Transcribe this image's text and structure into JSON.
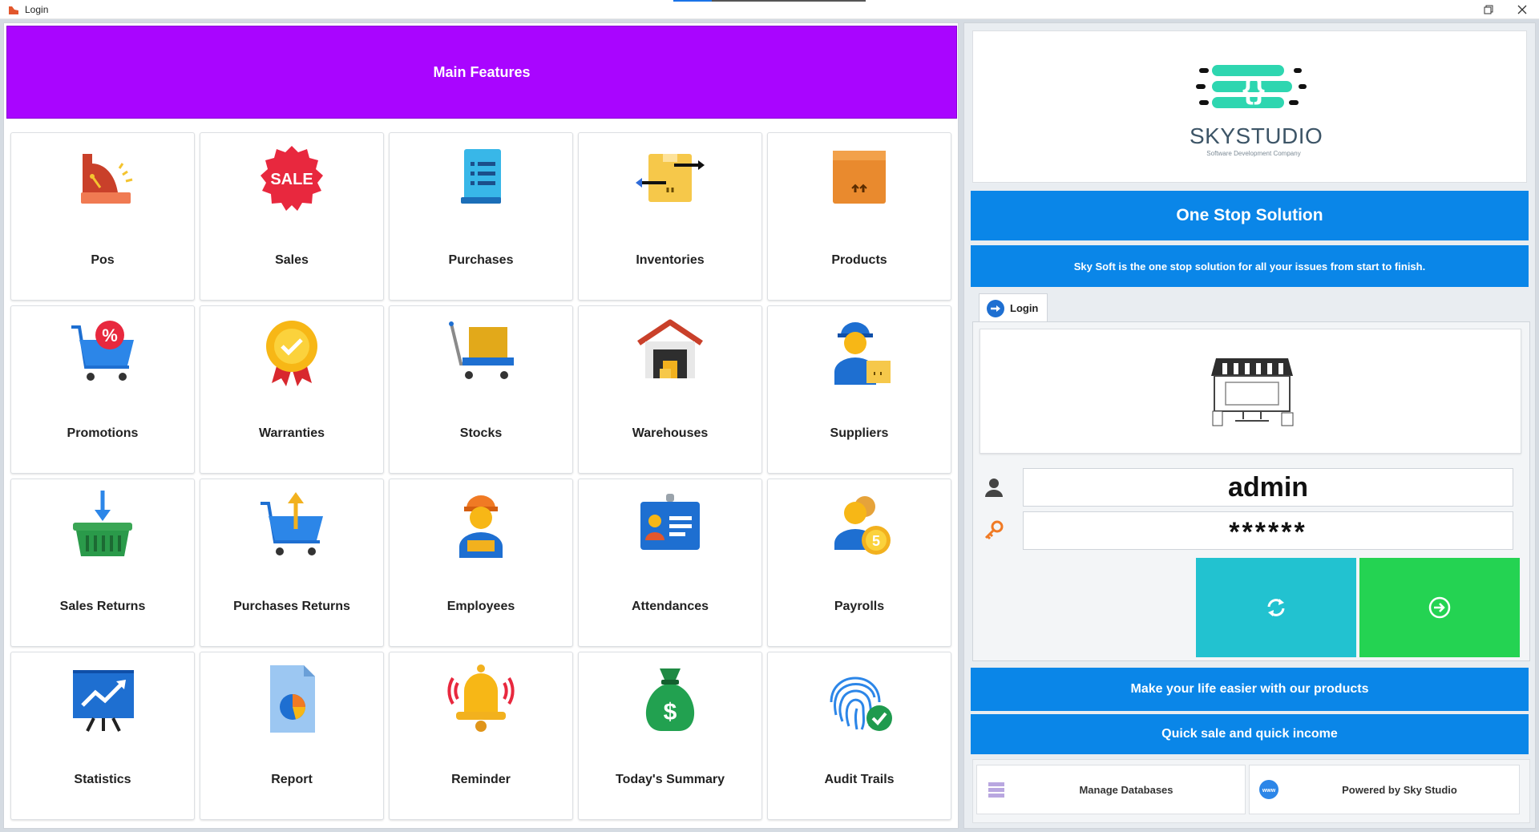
{
  "window": {
    "title": "Login"
  },
  "banner": {
    "title": "Main Features"
  },
  "features": [
    {
      "label": "Pos",
      "icon": "cash-register-icon"
    },
    {
      "label": "Sales",
      "icon": "sale-badge-icon"
    },
    {
      "label": "Purchases",
      "icon": "list-document-icon"
    },
    {
      "label": "Inventories",
      "icon": "box-transfer-icon"
    },
    {
      "label": "Products",
      "icon": "package-box-icon"
    },
    {
      "label": "Promotions",
      "icon": "cart-discount-icon"
    },
    {
      "label": "Warranties",
      "icon": "award-ribbon-icon"
    },
    {
      "label": "Stocks",
      "icon": "hand-truck-icon"
    },
    {
      "label": "Warehouses",
      "icon": "warehouse-icon"
    },
    {
      "label": "Suppliers",
      "icon": "delivery-person-icon"
    },
    {
      "label": "Sales Returns",
      "icon": "basket-return-icon"
    },
    {
      "label": "Purchases Returns",
      "icon": "cart-return-icon"
    },
    {
      "label": "Employees",
      "icon": "worker-icon"
    },
    {
      "label": "Attendances",
      "icon": "id-badge-icon"
    },
    {
      "label": "Payrolls",
      "icon": "people-coin-icon"
    },
    {
      "label": "Statistics",
      "icon": "chart-board-icon"
    },
    {
      "label": "Report",
      "icon": "report-pie-icon"
    },
    {
      "label": "Reminder",
      "icon": "bell-icon"
    },
    {
      "label": "Today's Summary",
      "icon": "money-bag-icon"
    },
    {
      "label": "Audit Trails",
      "icon": "fingerprint-check-icon"
    }
  ],
  "brand": {
    "name": "SKYSTUDIO",
    "tagline": "Software Development Company"
  },
  "headline": "One Stop Solution",
  "description": "Sky Soft is the one stop solution for all your issues from start to finish.",
  "login": {
    "tab_label": "Login",
    "username_value": "admin",
    "password_value": "******"
  },
  "slogans": {
    "line1": "Make your life easier with our products",
    "line2": "Quick sale and quick income"
  },
  "footer": {
    "manage_label": "Manage Databases",
    "powered_label": "Powered by Sky Studio"
  },
  "colors": {
    "banner": "#a905ff",
    "accent_blue": "#0a86e8",
    "refresh": "#22c2d0",
    "login": "#24d352",
    "brand_teal": "#2ed6b0"
  }
}
